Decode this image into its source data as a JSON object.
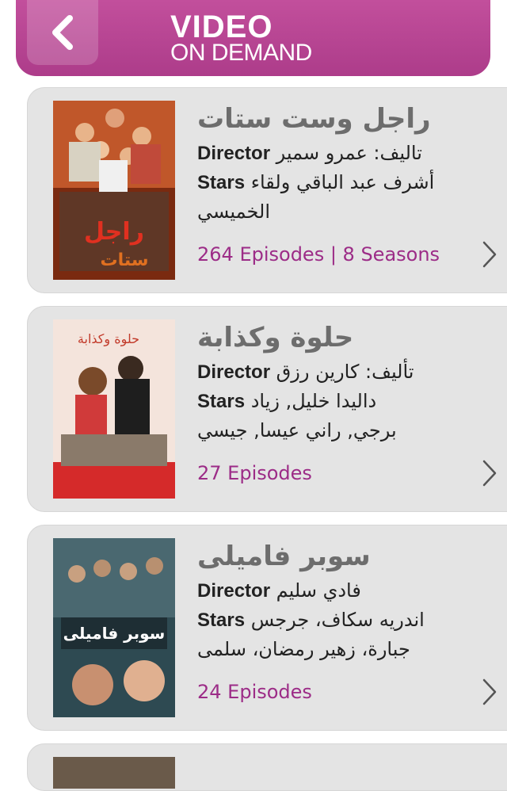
{
  "header": {
    "title_line1": "VIDEO",
    "title_line2": "ON DEMAND"
  },
  "shows": [
    {
      "title": "راجل وست ستات",
      "director_label": "Director",
      "director": "تاليف: عمرو سمير",
      "stars_label": "Stars",
      "stars_line1": "أشرف عبد الباقي ولقاء",
      "stars_line2": "الخميسي",
      "episodes": "264 Episodes | 8 Seasons"
    },
    {
      "title": "حلوة وكذابة",
      "director_label": "Director",
      "director": "تأليف: كارين رزق",
      "stars_label": "Stars",
      "stars_line1": "داليدا خليل, زياد",
      "stars_line2": "برجي, راني عيسا, جيسي",
      "episodes": "27 Episodes"
    },
    {
      "title": "سوبر فاميلى",
      "director_label": "Director",
      "director": "فادي سليم",
      "stars_label": "Stars",
      "stars_line1": "اندريه سكاف، جرجس",
      "stars_line2": "جبارة، زهير رمضان، سلمى",
      "episodes": "24 Episodes"
    }
  ],
  "colors": {
    "header": "#b8449a",
    "episodes": "#9c2c87",
    "card": "#e4e4e4"
  }
}
